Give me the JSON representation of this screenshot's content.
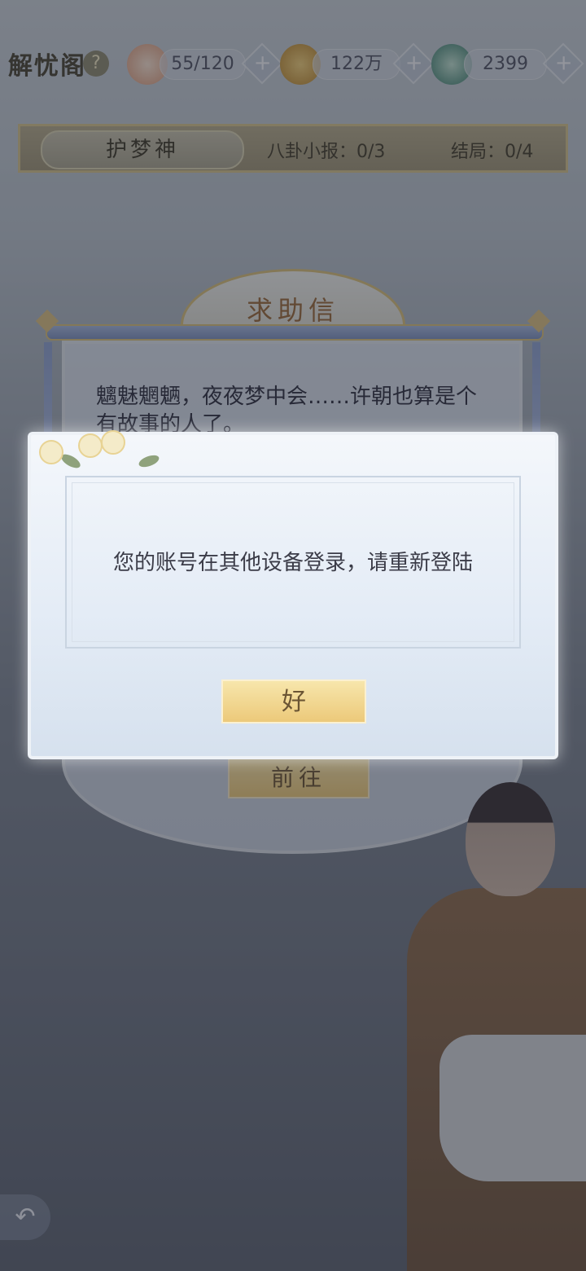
{
  "header": {
    "title": "解忧阁",
    "help_icon_glyph": "?",
    "resources": [
      {
        "icon": "cat-icon",
        "value": "55/120"
      },
      {
        "icon": "coin-icon",
        "value": "122万"
      },
      {
        "icon": "jade-icon",
        "value": "2399"
      }
    ],
    "plus_glyph": "+"
  },
  "info_strip": {
    "tag": "护梦神",
    "gossip": "八卦小报：0/3",
    "ending": "结局：0/4"
  },
  "letter": {
    "title": "求助信",
    "body": "魑魅魍魉，夜夜梦中会……许朝也算是个有故事的人了。",
    "go_label": "前往"
  },
  "dialog": {
    "message": "您的账号在其他设备登录，请重新登陆",
    "ok_label": "好"
  },
  "nav": {
    "back_glyph": "↶"
  },
  "colors": {
    "gold": "#ecc97a",
    "panel": "#e4ecf6",
    "letter_title": "#9a6b3b"
  }
}
